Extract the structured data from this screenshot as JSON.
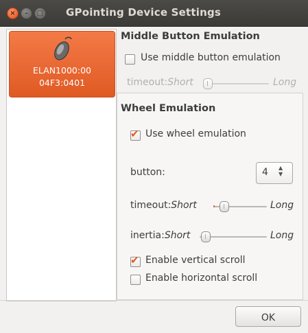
{
  "window": {
    "title": "GPointing Device Settings"
  },
  "sidebar": {
    "devices": [
      {
        "name_line1": "ELAN1000:00",
        "name_line2": "04F3:0401",
        "icon": "mouse-icon",
        "selected": true
      }
    ]
  },
  "middle_button": {
    "heading": "Middle Button Emulation",
    "use_label": "Use middle button emulation",
    "use_checked": false,
    "timeout_label": "timeout:",
    "timeout_short": "Short",
    "timeout_long": "Long",
    "timeout_value": 0.0,
    "enabled": false
  },
  "wheel": {
    "heading": "Wheel Emulation",
    "use_label": "Use wheel emulation",
    "use_checked": true,
    "button_label": "button:",
    "button_value": "4",
    "timeout_label": "timeout:",
    "timeout_short": "Short",
    "timeout_long": "Long",
    "timeout_value": 0.1,
    "inertia_label": "inertia:",
    "inertia_short": "Short",
    "inertia_long": "Long",
    "inertia_value": 0.0,
    "vertical_label": "Enable vertical scroll",
    "vertical_checked": true,
    "horizontal_label": "Enable horizontal scroll",
    "horizontal_checked": false
  },
  "footer": {
    "ok_label": "OK"
  },
  "colors": {
    "accent": "#e9561e",
    "titlebar": "#3c3b37",
    "selection": "#f07746"
  }
}
